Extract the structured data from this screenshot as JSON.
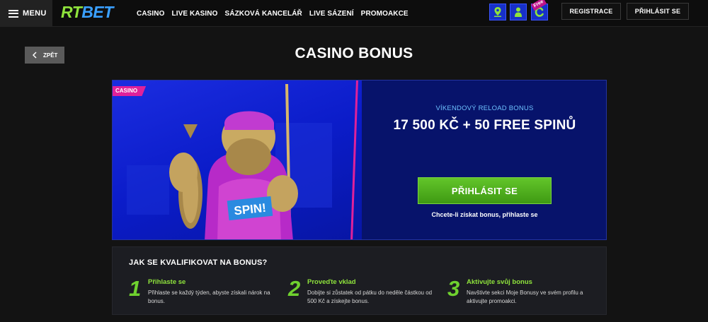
{
  "header": {
    "menu_label": "MENU",
    "logo_rt": "RT",
    "logo_bet": "BET",
    "nav": [
      "CASINO",
      "LIVE KASINO",
      "SÁZKOVÁ KANCELÁŘ",
      "LIVE SÁZENÍ",
      "PROMOAKCE"
    ],
    "free_tag": "Free",
    "register_label": "REGISTRACE",
    "login_label": "PŘIHLÁSIT SE"
  },
  "back_label": "ZPĚT",
  "page_title": "CASINO BONUS",
  "promo": {
    "badge": "CASINO",
    "subtitle": "VÍKENDOVÝ RELOAD BONUS",
    "headline": "17 500 KČ + 50 FREE SPINŮ",
    "cta_label": "PŘIHLÁSIT SE",
    "cta_hint": "Chcete-li získat bonus, přihlaste se",
    "image_text": "SPIN!"
  },
  "steps": {
    "title": "JAK SE KVALIFIKOVAT NA BONUS?",
    "items": [
      {
        "num": "1",
        "title": "Přihlaste se",
        "desc": "Přihlaste se každý týden, abyste získali nárok na bonus."
      },
      {
        "num": "2",
        "title": "Proveďte vklad",
        "desc": "Dobijte si zůstatek od pátku do neděle částkou od 500 Kč a získejte bonus."
      },
      {
        "num": "3",
        "title": "Aktivujte svůj bonus",
        "desc": "Navštivte sekci Moje Bonusy ve svém profilu a aktivujte promoakci."
      }
    ]
  },
  "colors": {
    "accent_green": "#6fd12f",
    "brand_blue": "#1730c9",
    "badge_pink": "#e0219a"
  }
}
